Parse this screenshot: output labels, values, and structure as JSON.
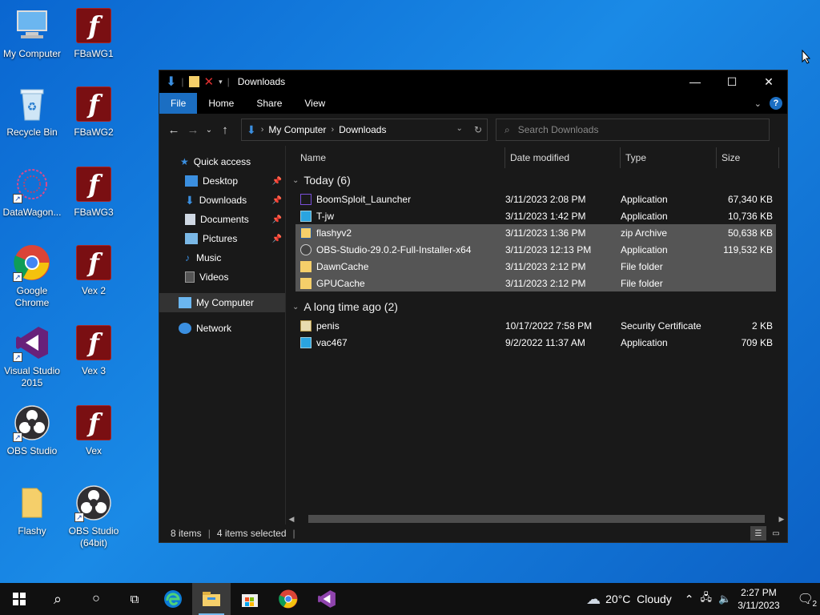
{
  "desktop": {
    "icons_left": [
      {
        "label": "My Computer",
        "icon": "computer-icon"
      },
      {
        "label": "Recycle Bin",
        "icon": "recycle-bin-icon"
      },
      {
        "label": "DataWagon...",
        "icon": "datawagon-icon"
      },
      {
        "label": "Google Chrome",
        "icon": "chrome-icon"
      },
      {
        "label": "Visual Studio 2015",
        "icon": "visual-studio-icon"
      },
      {
        "label": "OBS Studio",
        "icon": "obs-icon"
      },
      {
        "label": "Flashy",
        "icon": "folder-icon"
      }
    ],
    "icons_right": [
      {
        "label": "FBaWG1",
        "icon": "flash-icon"
      },
      {
        "label": "FBaWG2",
        "icon": "flash-icon"
      },
      {
        "label": "FBaWG3",
        "icon": "flash-icon"
      },
      {
        "label": "Vex 2",
        "icon": "flash-icon"
      },
      {
        "label": "Vex 3",
        "icon": "flash-icon"
      },
      {
        "label": "Vex",
        "icon": "flash-icon"
      },
      {
        "label": "OBS Studio (64bit)",
        "icon": "obs-icon"
      }
    ]
  },
  "window": {
    "title": "Downloads",
    "controls": {
      "minimize": "—",
      "maximize": "☐",
      "close": "✕"
    },
    "ribbon_tabs": [
      "File",
      "Home",
      "Share",
      "View"
    ],
    "address": {
      "root": "My Computer",
      "current": "Downloads"
    },
    "search_placeholder": "Search Downloads",
    "columns": {
      "name": "Name",
      "date": "Date modified",
      "type": "Type",
      "size": "Size"
    },
    "nav_pane": {
      "quick_access": "Quick access",
      "items": [
        "Desktop",
        "Downloads",
        "Documents",
        "Pictures",
        "Music",
        "Videos"
      ],
      "my_computer": "My Computer",
      "network": "Network"
    },
    "groups": [
      {
        "label": "Today (6)",
        "files": [
          {
            "name": "BoomSploit_Launcher",
            "date": "3/11/2023 2:08 PM",
            "type": "Application",
            "size": "67,340 KB",
            "selected": false,
            "icon": "launcher-icon"
          },
          {
            "name": "T-jw",
            "date": "3/11/2023 1:42 PM",
            "type": "Application",
            "size": "10,736 KB",
            "selected": false,
            "icon": "app-icon"
          },
          {
            "name": "flashyv2",
            "date": "3/11/2023 1:36 PM",
            "type": "zip Archive",
            "size": "50,638 KB",
            "selected": true,
            "icon": "zip-icon"
          },
          {
            "name": "OBS-Studio-29.0.2-Full-Installer-x64",
            "date": "3/11/2023 12:13 PM",
            "type": "Application",
            "size": "119,532 KB",
            "selected": true,
            "icon": "obs-installer-icon"
          },
          {
            "name": "DawnCache",
            "date": "3/11/2023 2:12 PM",
            "type": "File folder",
            "size": "",
            "selected": true,
            "icon": "folder-icon"
          },
          {
            "name": "GPUCache",
            "date": "3/11/2023 2:12 PM",
            "type": "File folder",
            "size": "",
            "selected": true,
            "icon": "folder-icon"
          }
        ]
      },
      {
        "label": "A long time ago (2)",
        "files": [
          {
            "name": "penis",
            "date": "10/17/2022 7:58 PM",
            "type": "Security Certificate",
            "size": "2 KB",
            "selected": false,
            "icon": "certificate-icon"
          },
          {
            "name": "vac467",
            "date": "9/2/2022 11:37 AM",
            "type": "Application",
            "size": "709 KB",
            "selected": false,
            "icon": "app-icon"
          }
        ]
      }
    ],
    "status": {
      "items": "8 items",
      "selected": "4 items selected"
    }
  },
  "taskbar": {
    "weather": "20°C  Cloudy",
    "time": "2:27 PM",
    "date": "3/11/2023",
    "notifications": "2"
  },
  "colors": {
    "accent": "#1b6ec2",
    "selection": "#555555",
    "taskbar": "#101010"
  }
}
